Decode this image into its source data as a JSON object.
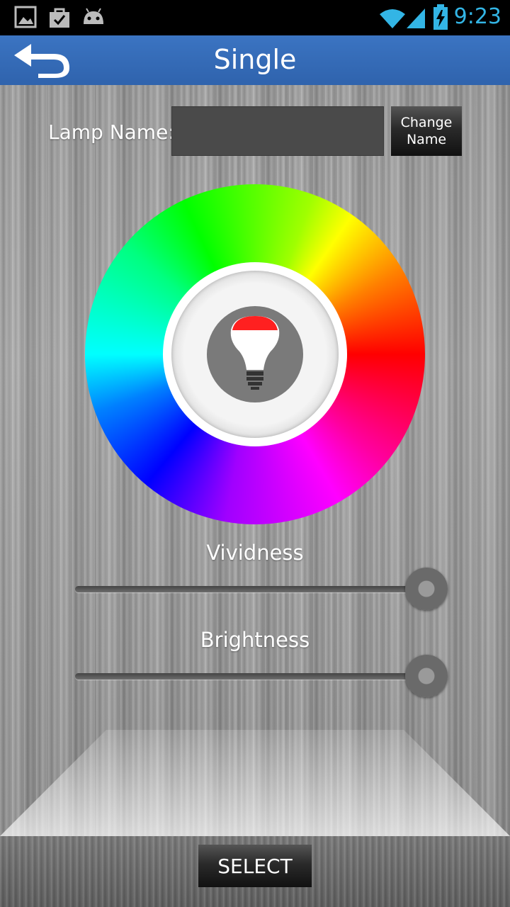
{
  "status_bar": {
    "time": "9:23",
    "notification_icons": [
      "gallery-icon",
      "shopping-bag-icon",
      "android-icon"
    ],
    "system_icons": [
      "wifi-icon",
      "signal-icon",
      "battery-charging-icon"
    ]
  },
  "action_bar": {
    "title": "Single",
    "back_icon": "back-arrow-icon"
  },
  "lamp": {
    "label": "Lamp Name:",
    "name_value": "",
    "change_button_line1": "Change",
    "change_button_line2": "Name"
  },
  "color_wheel": {
    "selected_color": "#ff2020",
    "center_icon": "light-bulb-icon"
  },
  "sliders": {
    "vividness": {
      "label": "Vividness",
      "value": 1.0
    },
    "brightness": {
      "label": "Brightness",
      "value": 1.0
    }
  },
  "bottom": {
    "select_label": "SELECT"
  },
  "colors": {
    "action_bar": "#3068b5",
    "status_accent": "#33b5e5"
  }
}
